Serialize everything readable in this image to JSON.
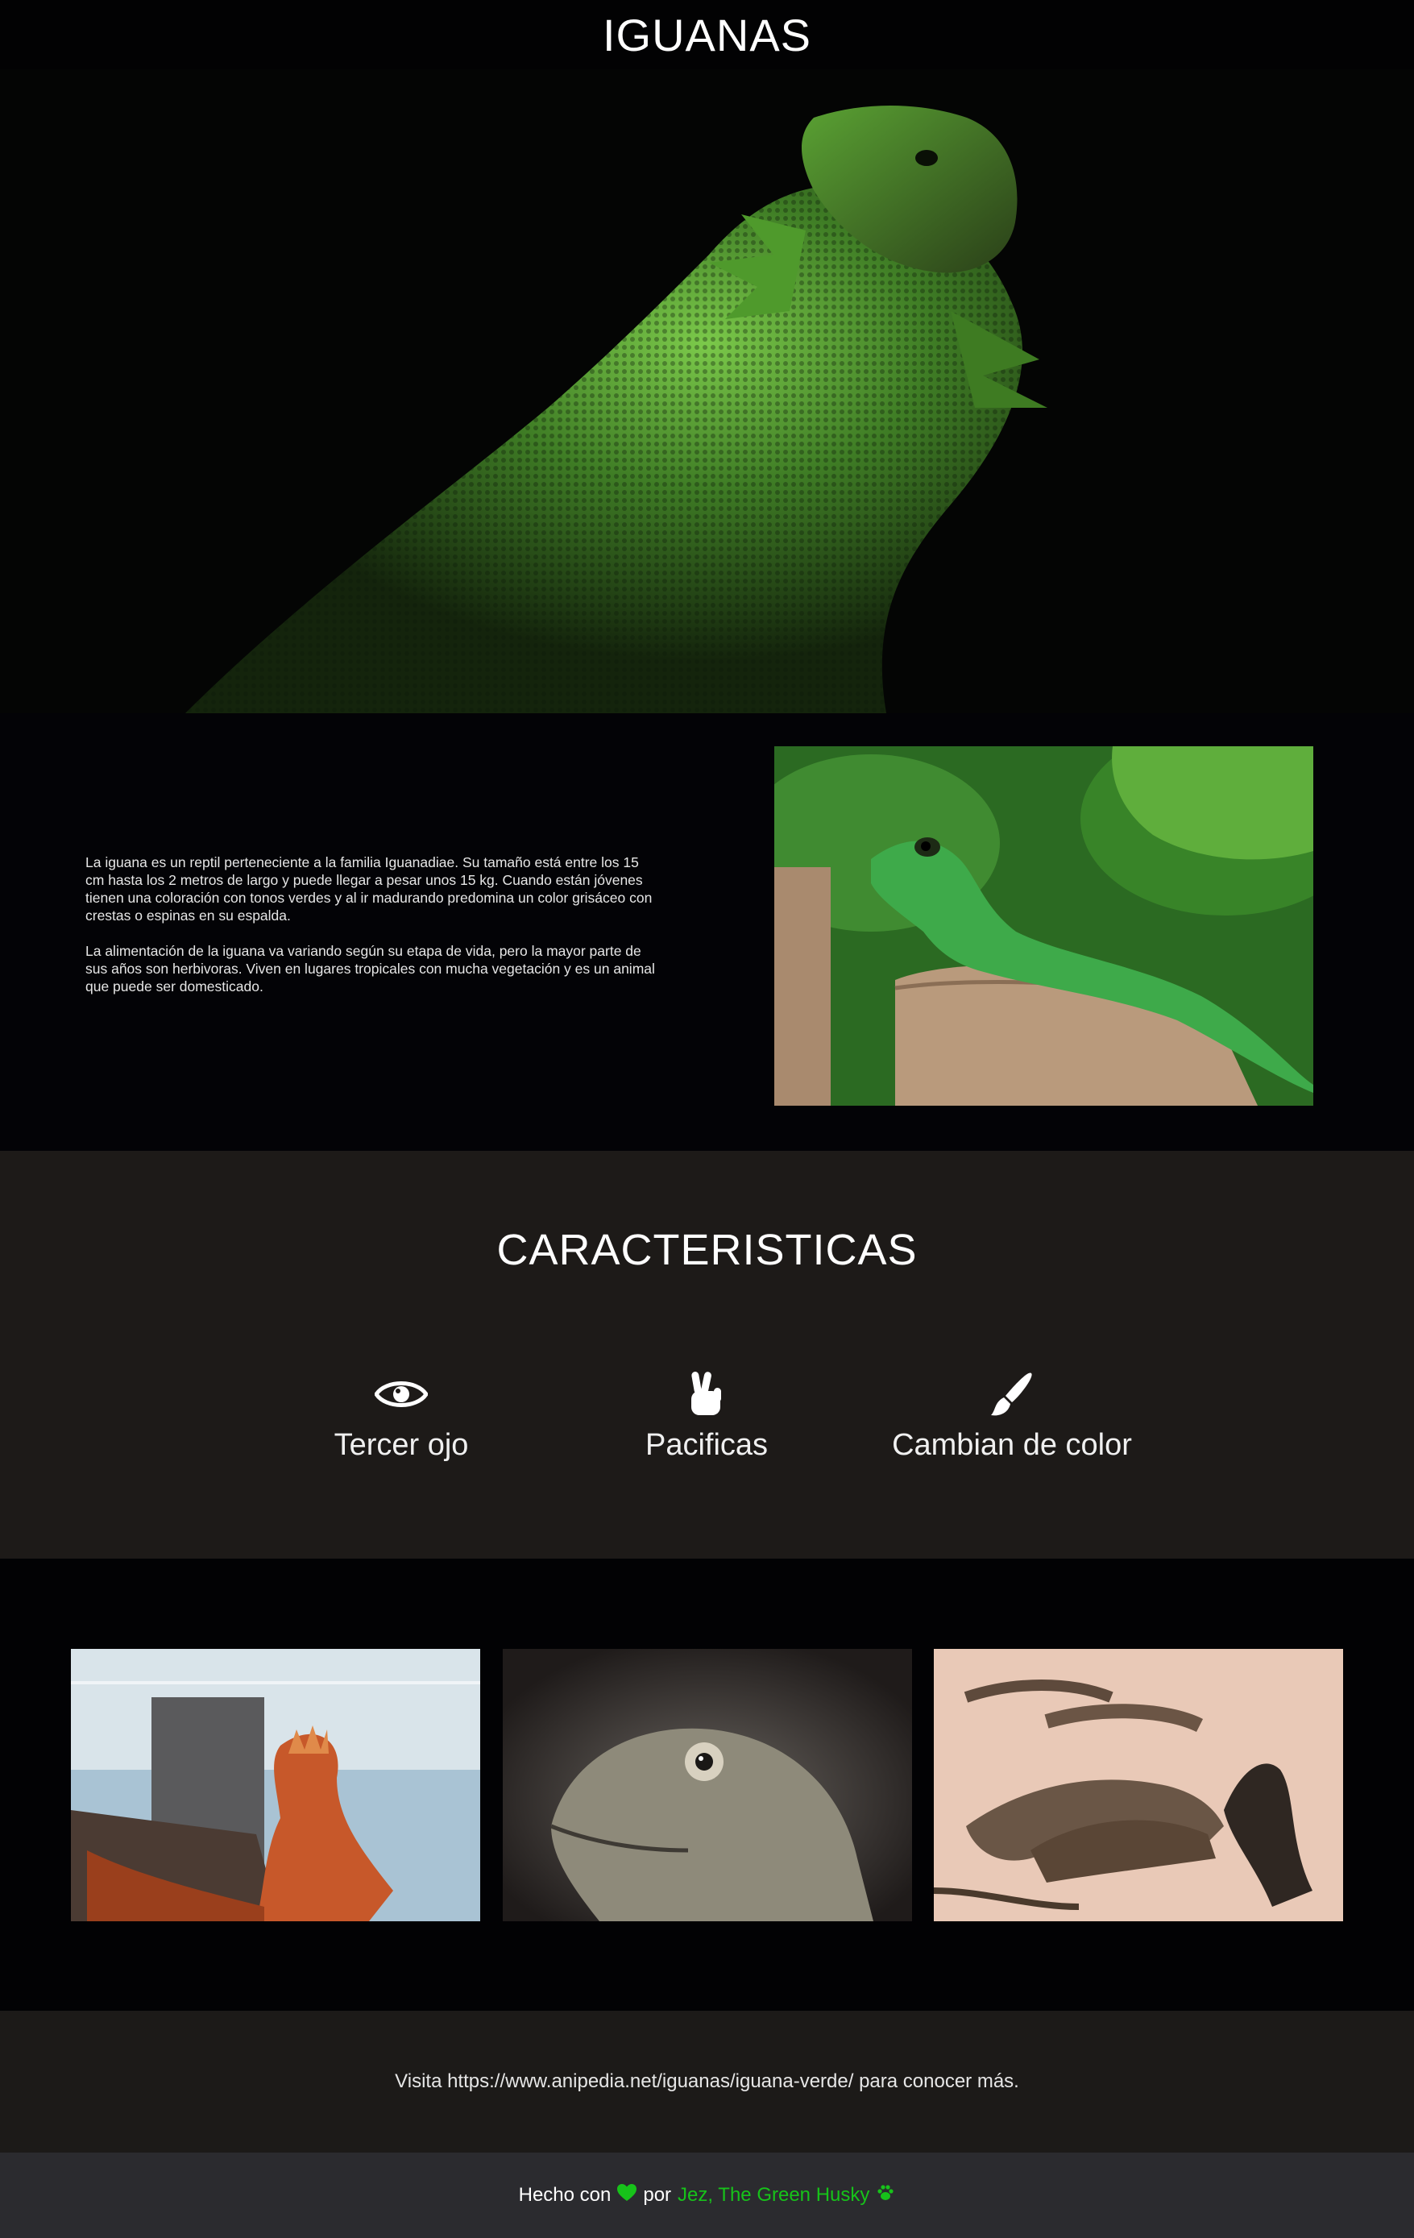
{
  "header": {
    "title": "IGUANAS"
  },
  "intro": {
    "paragraphs": [
      "La iguana es un reptil perteneciente a la familia Iguanadiae. Su tamaño está entre los 15 cm hasta los 2 metros de largo y puede llegar a pesar unos 15 kg. Cuando están jóvenes tienen una coloración con tonos verdes y al ir madurando predomina un color grisáceo con crestas o espinas en su espalda.",
      "La alimentación de la iguana va variando según su etapa de vida, pero la mayor parte de sus años son herbivoras. Viven en lugares tropicales con mucha vegetación y es un animal que puede ser domesticado."
    ]
  },
  "features": {
    "title": "CARACTERISTICAS",
    "items": [
      {
        "icon": "eye-icon",
        "label": "Tercer ojo"
      },
      {
        "icon": "hand-peace-icon",
        "label": "Pacificas"
      },
      {
        "icon": "paint-brush-icon",
        "label": "Cambian de color"
      }
    ]
  },
  "visit": {
    "text": "Visita https://www.anipedia.net/iguanas/iguana-verde/ para conocer más."
  },
  "footer": {
    "made_with": "Hecho con",
    "by": "por",
    "author": "Jez, The Green Husky",
    "heart_icon": "heart-icon",
    "paw_icon": "paw-icon",
    "accent_color": "#17c21a"
  }
}
